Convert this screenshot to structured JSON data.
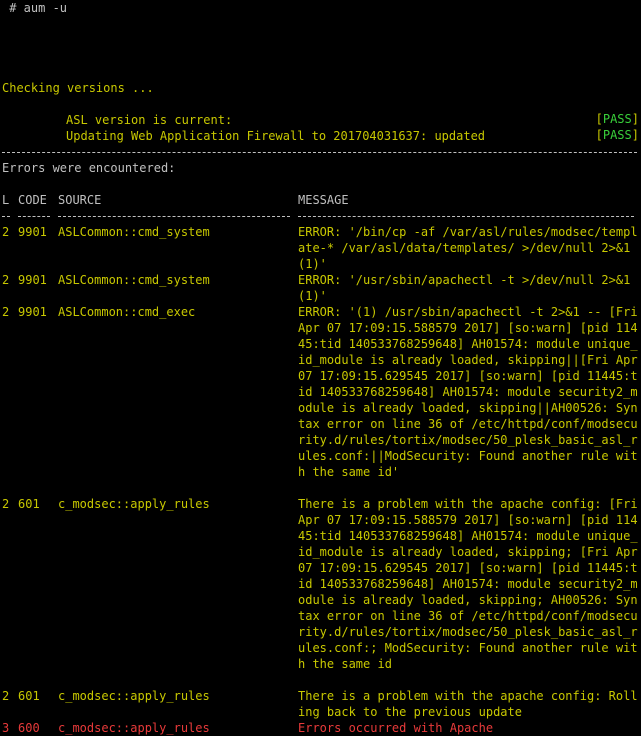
{
  "terminal": {
    "prompt_line": " # aum -u",
    "checking": "Checking versions ...",
    "checks": [
      {
        "label": "ASL version is current:",
        "status": "PASS"
      },
      {
        "label": "Updating Web Application Firewall to 201704031637: updated",
        "status": "PASS"
      }
    ],
    "errors_header": "Errors were encountered:",
    "table": {
      "headers": {
        "level": "L",
        "code": "CODE",
        "source": "SOURCE",
        "message": "MESSAGE"
      },
      "rows": [
        {
          "level": "2",
          "code": "9901",
          "source": "ASLCommon::cmd_system",
          "severity": "warn",
          "message": "ERROR: '/bin/cp -af /var/asl/rules/modsec/template-* /var/asl/data/templates/ >/dev/null 2>&1 (1)'"
        },
        {
          "level": "2",
          "code": "9901",
          "source": "ASLCommon::cmd_system",
          "severity": "warn",
          "message": "ERROR: '/usr/sbin/apachectl -t >/dev/null 2>&1 (1)'"
        },
        {
          "level": "2",
          "code": "9901",
          "source": "ASLCommon::cmd_exec",
          "severity": "warn",
          "message": "ERROR: '(1) /usr/sbin/apachectl -t 2>&1 -- [Fri Apr 07 17:09:15.588579 2017] [so:warn] [pid 11445:tid 140533768259648] AH01574: module unique_id_module is already loaded, skipping||[Fri Apr 07 17:09:15.629545 2017] [so:warn] [pid 11445:tid 140533768259648] AH01574: module security2_module is already loaded, skipping||AH00526: Syntax error on line 36 of /etc/httpd/conf/modsecurity.d/rules/tortix/modsec/50_plesk_basic_asl_rules.conf:||ModSecurity: Found another rule with the same id'"
        },
        {
          "level": "2",
          "code": "601",
          "source": "c_modsec::apply_rules",
          "severity": "warn",
          "message": "There is a problem with the apache config: [Fri Apr 07 17:09:15.588579 2017] [so:warn] [pid 11445:tid 140533768259648] AH01574: module unique_id_module is already loaded, skipping; [Fri Apr 07 17:09:15.629545 2017] [so:warn] [pid 11445:tid 140533768259648] AH01574: module security2_module is already loaded, skipping; AH00526: Syntax error on line 36 of /etc/httpd/conf/modsecurity.d/rules/tortix/modsec/50_plesk_basic_asl_rules.conf:; ModSecurity: Found another rule with the same id"
        },
        {
          "level": "2",
          "code": "601",
          "source": "c_modsec::apply_rules",
          "severity": "warn",
          "message": "There is a problem with the apache config: Rolling back to the previous update"
        },
        {
          "level": "3",
          "code": "600",
          "source": "c_modsec::apply_rules",
          "severity": "error",
          "message": "Errors occurred with Apache"
        }
      ]
    },
    "colors": {
      "background": "#000000",
      "text": "#c0c0c0",
      "warn": "#c8c800",
      "error": "#e83a3a",
      "pass": "#39d03a"
    }
  }
}
